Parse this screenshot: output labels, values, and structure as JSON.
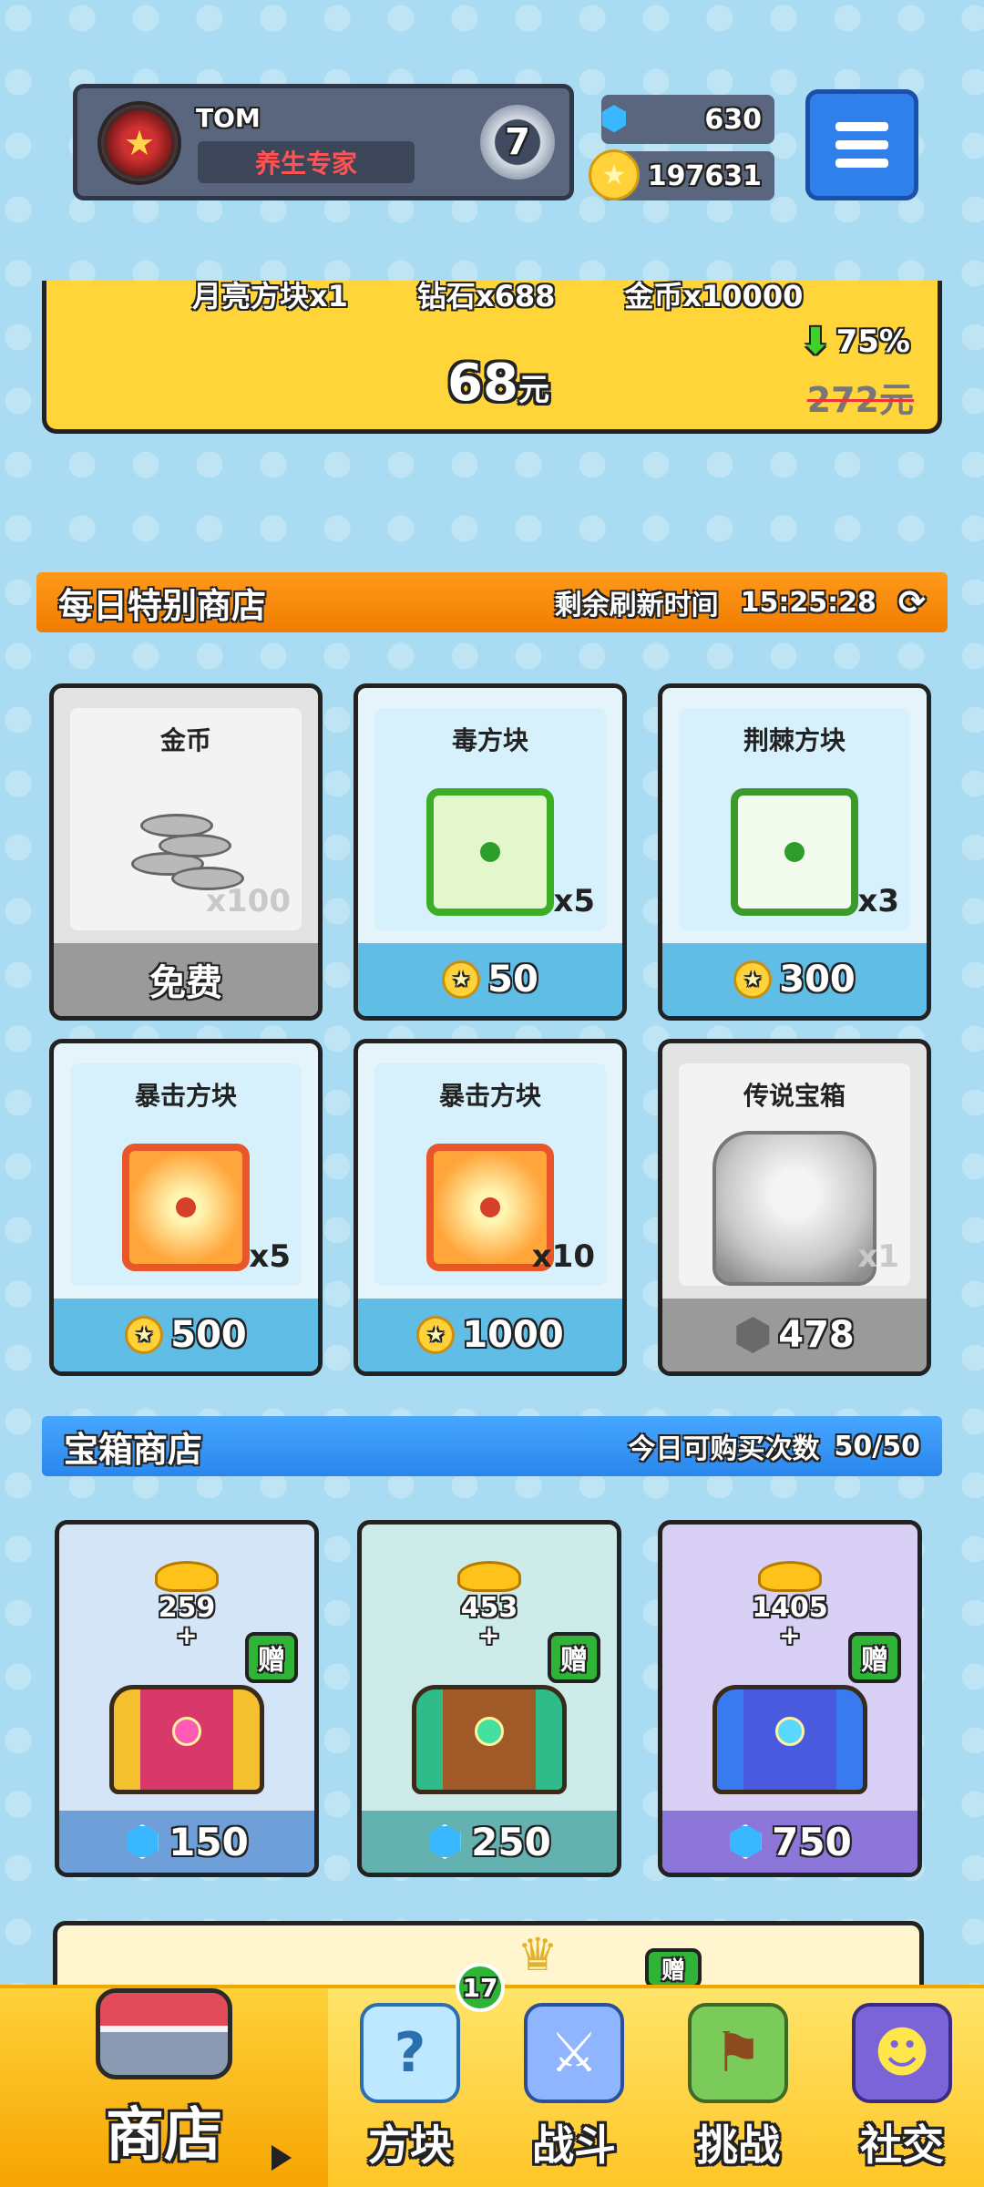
{
  "header": {
    "player_name": "TOM",
    "player_title": "养生专家",
    "rank_level": "7",
    "gems": "630",
    "coins": "197631"
  },
  "banner": {
    "items": [
      "月亮方块x1",
      "钻石x688",
      "金币x10000"
    ],
    "price": "68",
    "price_unit": "元",
    "discount": "75%",
    "old_price": "272元"
  },
  "daily_shop": {
    "title": "每日特别商店",
    "refresh_label": "剩余刷新时间",
    "refresh_time": "15:25:28",
    "items": [
      {
        "name": "金币",
        "qty": "x100",
        "price": "免费"
      },
      {
        "name": "毒方块",
        "qty": "x5",
        "price": "50"
      },
      {
        "name": "荆棘方块",
        "qty": "x3",
        "price": "300"
      },
      {
        "name": "暴击方块",
        "qty": "x5",
        "price": "500"
      },
      {
        "name": "暴击方块",
        "qty": "x10",
        "price": "1000"
      },
      {
        "name": "传说宝箱",
        "qty": "x1",
        "price": "478"
      }
    ]
  },
  "chest_shop": {
    "title": "宝箱商店",
    "limit_label": "今日可购买次数",
    "limit_value": "50/50",
    "gift_label": "赠",
    "chests": [
      {
        "bonus": "259",
        "price": "150"
      },
      {
        "bonus": "453",
        "price": "250"
      },
      {
        "bonus": "1405",
        "price": "750"
      }
    ],
    "partial_gift_label": "赠"
  },
  "nav": {
    "shop": "商店",
    "blocks": "方块",
    "blocks_badge": "17",
    "battle": "战斗",
    "challenge": "挑战",
    "social": "社交"
  },
  "colors": {
    "daily_bar": "#f07c00",
    "chest_bar": "#2a86ec",
    "nav_bg": "#ffc627"
  }
}
